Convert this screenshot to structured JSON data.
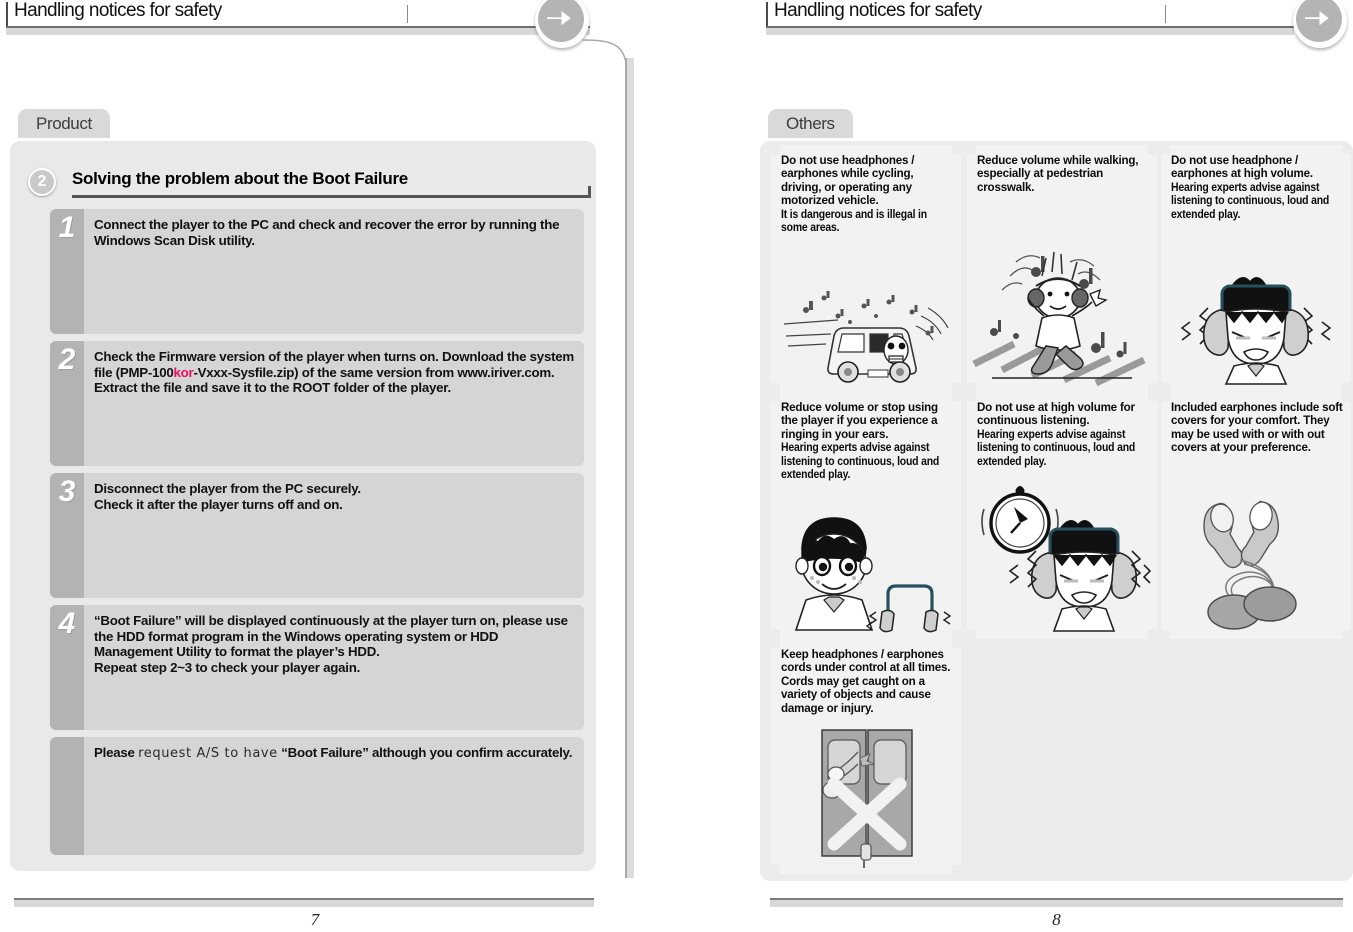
{
  "left_page": {
    "header": {
      "title": "Handling notices for safety",
      "arrow_icon": "arrow-right-icon"
    },
    "tab": {
      "label": "Product"
    },
    "section": {
      "number": "2",
      "title": "Solving the problem about the Boot Failure"
    },
    "steps": [
      {
        "number": "1",
        "text": "Connect the player to the PC and check and recover the error by running the Windows Scan Disk utility."
      },
      {
        "number": "2",
        "text_before": "Check the Firmware version of the player when turns on. Download the system file (PMP-100",
        "highlight": "kor",
        "highlight_color": "#ec1165",
        "text_after": "-Vxxx-Sysfile.zip) of the same version from www.iriver.com. Extract the file and save it to the ROOT folder of the player."
      },
      {
        "number": "3",
        "text": "Disconnect the player from the PC securely.\nCheck it after the player turns off and on."
      },
      {
        "number": "4",
        "text": "“Boot Failure” will be displayed continuously at the player turn on, please use the HDD format program in the Windows operating system or HDD Management Utility to format the player’s HDD.\nRepeat step 2~3 to check your player again."
      },
      {
        "number": "",
        "text_before": "Please ",
        "handwritten": "request A/S to have",
        "text_after": " “Boot Failure” although you confirm accurately."
      }
    ],
    "footer": {
      "page_number": "7"
    }
  },
  "right_page": {
    "header": {
      "title": "Handling notices for safety",
      "arrow_icon": "arrow-right-icon"
    },
    "tab": {
      "label": "Others"
    },
    "cards": [
      {
        "id": "card-cycling-driving",
        "line_main": "Do not use headphones / earphones while cycling, driving, or operating any motorized vehicle.",
        "line_narrow": "It is dangerous and is illegal in some areas.",
        "art": "van-icon"
      },
      {
        "id": "card-walking-crosswalk",
        "line_main": "Reduce volume while walking, especially at pedestrian crosswalk.",
        "line_narrow": "",
        "art": "walking-person-icon"
      },
      {
        "id": "card-high-volume",
        "line_main": "Do not use headphone / earphones at high volume.",
        "line_narrow": "Hearing experts advise against listening to continuous, loud and extended play.",
        "art": "angry-headphones-icon"
      },
      {
        "id": "card-ringing-ears",
        "line_main": "Reduce volume or stop using the player if you experience a ringing in your ears.",
        "line_narrow": "Hearing experts advise against listening to continuous, loud and extended play.",
        "art": "boy-earbuds-icon"
      },
      {
        "id": "card-continuous-listening",
        "line_main": "Do not use at high volume for continuous listening.",
        "line_narrow": "Hearing experts advise against listening to continuous, loud and extended play.",
        "art": "clock-angry-headphones-icon"
      },
      {
        "id": "card-soft-covers",
        "line_main": "Included earphones include soft covers for your comfort. They may be used with or with out covers at your preference.",
        "line_narrow": "",
        "art": "earbuds-covers-icon"
      },
      {
        "id": "card-cords-control",
        "line_main": "Keep headphones / earphones cords under control at all times. Cords may get caught on a variety of objects and cause damage or injury.",
        "line_narrow": "",
        "art": "cord-caught-door-icon"
      }
    ],
    "footer": {
      "page_number": "8"
    }
  },
  "colors": {
    "panel_bg": "#e9e9e9",
    "card_bg": "#f2f2f2",
    "step_bg": "#d5d5d5",
    "step_bar": "#b3b3b3",
    "accent_pink": "#ec1165",
    "rule_dark": "#6e6e6e",
    "rule_light": "#d8d8d8"
  }
}
